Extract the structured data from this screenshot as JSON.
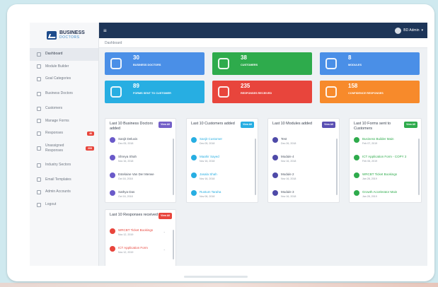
{
  "brand": {
    "line1": "BUSINESS",
    "line2": "DOCTORS"
  },
  "sidebar": {
    "items": [
      {
        "label": "Dashboard",
        "icon": "home-icon",
        "active": true
      },
      {
        "label": "Module Builder",
        "icon": "grid-icon"
      },
      {
        "label": "Goal Categories",
        "icon": "list-icon"
      },
      {
        "label": "Business Doctors",
        "icon": "user-icon"
      },
      {
        "label": "Customers",
        "icon": "users-icon"
      },
      {
        "label": "Manage Forms",
        "icon": "form-icon"
      },
      {
        "label": "Responses",
        "icon": "reply-icon",
        "badge": "46"
      },
      {
        "label": "Unassigned Responses",
        "icon": "chart-icon",
        "badge": "209"
      },
      {
        "label": "Industry Sectors",
        "icon": "sector-icon"
      },
      {
        "label": "Email Templates",
        "icon": "mail-icon"
      },
      {
        "label": "Admin Accounts",
        "icon": "gear-icon"
      },
      {
        "label": "Logout",
        "icon": "power-icon"
      }
    ]
  },
  "topbar": {
    "user": "BD Admin"
  },
  "breadcrumb": "Dashboard",
  "tiles": [
    {
      "num": "30",
      "label": "BUSINESS DOCTORS",
      "color": "#4a8fe7",
      "icon": "doctor-icon"
    },
    {
      "num": "38",
      "label": "CUSTOMERS",
      "color": "#2eab4c",
      "icon": "customer-icon"
    },
    {
      "num": "8",
      "label": "MODULES",
      "color": "#4a8fe7",
      "icon": "module-icon"
    },
    {
      "num": "89",
      "label": "FORMS SENT TO CUSTOMER",
      "color": "#27aee2",
      "icon": "form-sent-icon"
    },
    {
      "num": "235",
      "label": "RESPONSES RECEIVED",
      "color": "#e8453c",
      "icon": "response-icon"
    },
    {
      "num": "158",
      "label": "CONFIDENCE RESPONSES",
      "color": "#f78a2b",
      "icon": "share-icon"
    }
  ],
  "cards": {
    "doctors": {
      "title": "Last 10 Business Doctors added",
      "view_all": "View All",
      "badge_color": "#7460c8",
      "rows": [
        {
          "name": "Sanjit Deluxis",
          "date": "Dec 05, 2018"
        },
        {
          "name": "Shreya Shah",
          "date": "Nov 16, 2018"
        },
        {
          "name": "Estelaine Van Der Merwe",
          "date": "Oct 16, 2018"
        },
        {
          "name": "Sathya Das",
          "date": "Oct 16, 2018"
        }
      ]
    },
    "customers": {
      "title": "Last 10 Customers added",
      "view_all": "View All",
      "badge_color": "#27aee2",
      "rows": [
        {
          "name": "Sanjit Customer",
          "date": "Dec 05, 2018"
        },
        {
          "name": "Maahir Sayed",
          "date": "Nov 16, 2018"
        },
        {
          "name": "Jasala Shah",
          "date": "Nov 16, 2018"
        },
        {
          "name": "Rustum Taraha",
          "date": "Nov 06, 2018"
        }
      ]
    },
    "modules": {
      "title": "Last 10 Modules added",
      "view_all": "View All",
      "badge_color": "#5a4fb3",
      "rows": [
        {
          "name": "Test",
          "date": "Dec 26, 2018"
        },
        {
          "name": "Module 4",
          "date": "Nov 16, 2018"
        },
        {
          "name": "Module 2",
          "date": "Nov 16, 2018"
        },
        {
          "name": "Module 3",
          "date": "Nov 16, 2018"
        }
      ]
    },
    "forms": {
      "title": "Last 10 Forms sent to Customers",
      "view_all": "View All",
      "badge_color": "#2eab4c",
      "rows": [
        {
          "name": "Business Builder Main",
          "date": "Feb 07, 2019"
        },
        {
          "name": "ICT Application Form - COPY 2",
          "date": "Feb 06, 2019"
        },
        {
          "name": "WRCBT Ticket Bookings",
          "date": "Jan 28, 2019"
        },
        {
          "name": "Growth Accelerator Main",
          "date": "Jan 28, 2019"
        }
      ]
    },
    "responses": {
      "title": "Last 10 Responses received",
      "view_all": "View All",
      "badge_color": "#e8453c",
      "rows": [
        {
          "name": "WRCBT Ticket Bookings",
          "date": "Nov 12, 2019"
        },
        {
          "name": "ICT Application Form",
          "date": "Nov 12, 2019"
        }
      ]
    }
  },
  "colors": {
    "topbar": "#1d3558",
    "purple_icon": "#6a5ac9",
    "teal_icon": "#27aee2",
    "green_icon": "#2eab4c",
    "red_icon": "#e8453c"
  }
}
